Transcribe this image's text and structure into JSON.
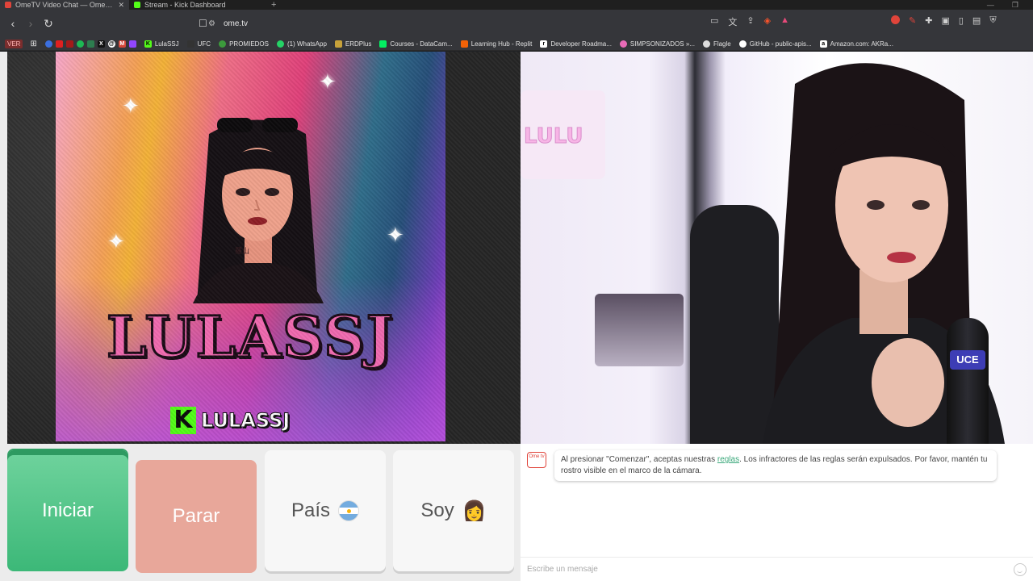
{
  "browser": {
    "tabs": [
      {
        "title": "OmeTV Video Chat — Omegle",
        "active": true
      },
      {
        "title": "Stream - Kick Dashboard",
        "active": false
      }
    ],
    "new_tab_symbol": "+",
    "address": "ome.tv",
    "bookmarks": [
      {
        "label": "VER"
      },
      {
        "label": "LulaSSJ"
      },
      {
        "label": "UFC"
      },
      {
        "label": "PROMIEDOS"
      },
      {
        "label": "(1) WhatsApp"
      },
      {
        "label": "ERDPlus"
      },
      {
        "label": "Courses - DataCam..."
      },
      {
        "label": "Learning Hub - Replit"
      },
      {
        "label": "Developer Roadma..."
      },
      {
        "label": "SIMPSONIZADOS »..."
      },
      {
        "label": "Flagle"
      },
      {
        "label": "GitHub - public-apis..."
      },
      {
        "label": "Amazon.com: AKRa..."
      }
    ]
  },
  "left_video": {
    "poster_title": "LULASSJ",
    "kick_name": "LULASSJ",
    "kick_letter": "K",
    "neck_tattoo": "羅山",
    "colors": {
      "kick_green": "#53fc18",
      "title_pink": "#f06ab0"
    }
  },
  "right_video": {
    "wall_sign": "LULU",
    "mic_label": "UCE"
  },
  "controls": {
    "start_label": "Iniciar",
    "stop_label": "Parar",
    "country_label": "País",
    "gender_label": "Soy",
    "gender_emoji": "👩",
    "colors": {
      "start": "#3cb878",
      "stop": "#e8a79a"
    }
  },
  "chat": {
    "logo_text": "Ome tv",
    "message_before": "Al presionar \"Comenzar\", aceptas nuestras ",
    "message_link": "reglas",
    "message_after": ". Los infractores de las reglas serán expulsados. Por favor, mantén tu rostro visible en el marco de la cámara.",
    "input_placeholder": "Escribe un mensaje"
  }
}
